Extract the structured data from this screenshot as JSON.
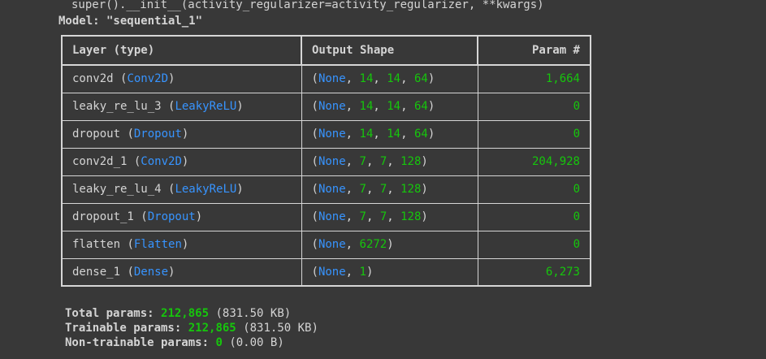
{
  "warning_line": "super().__init__(activity_regularizer=activity_regularizer, **kwargs)",
  "model_line": "Model: \"sequential_1\"",
  "headers": [
    "Layer (type)",
    "Output Shape",
    "Param #"
  ],
  "rows": [
    {
      "name": "conv2d",
      "type": "Conv2D",
      "dims": [
        "14",
        "14",
        "64"
      ],
      "params": "1,664"
    },
    {
      "name": "leaky_re_lu_3",
      "type": "LeakyReLU",
      "dims": [
        "14",
        "14",
        "64"
      ],
      "params": "0"
    },
    {
      "name": "dropout",
      "type": "Dropout",
      "dims": [
        "14",
        "14",
        "64"
      ],
      "params": "0"
    },
    {
      "name": "conv2d_1",
      "type": "Conv2D",
      "dims": [
        "7",
        "7",
        "128"
      ],
      "params": "204,928"
    },
    {
      "name": "leaky_re_lu_4",
      "type": "LeakyReLU",
      "dims": [
        "7",
        "7",
        "128"
      ],
      "params": "0"
    },
    {
      "name": "dropout_1",
      "type": "Dropout",
      "dims": [
        "7",
        "7",
        "128"
      ],
      "params": "0"
    },
    {
      "name": "flatten",
      "type": "Flatten",
      "dims": [
        "6272"
      ],
      "params": "0"
    },
    {
      "name": "dense_1",
      "type": "Dense",
      "dims": [
        "1"
      ],
      "params": "6,273"
    }
  ],
  "none_token": "None",
  "summary": [
    {
      "label": "Total params:",
      "value": "212,865",
      "size": "(831.50 KB)"
    },
    {
      "label": "Trainable params:",
      "value": "212,865",
      "size": "(831.50 KB)"
    },
    {
      "label": "Non-trainable params:",
      "value": "0",
      "size": "(0.00 B)"
    }
  ],
  "colors": {
    "type": "#3794ff",
    "number": "#16c60c",
    "text": "#d4d4d4",
    "background": "#383838"
  }
}
